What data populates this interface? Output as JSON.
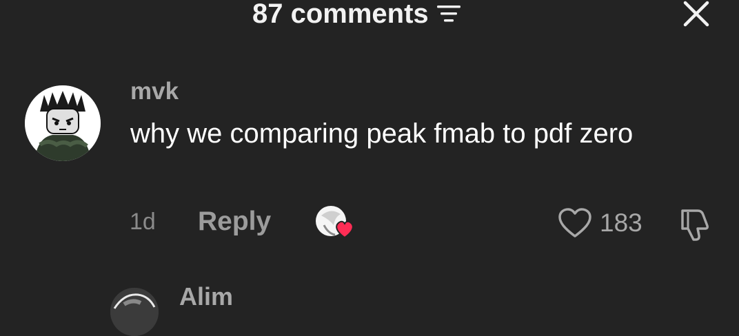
{
  "header": {
    "title": "87 comments",
    "sort_icon": "sort-lines-icon",
    "close_icon": "close-icon"
  },
  "comment": {
    "username": "mvk",
    "text": "why we comparing peak fmab to pdf zero",
    "time": "1d",
    "reply_label": "Reply",
    "likes": "183",
    "like_icon": "heart-outline-icon",
    "dislike_icon": "thumbs-down-icon",
    "creator_liked_icon": "creator-heart-avatar-icon",
    "accent_heart_color": "#ff2d55"
  },
  "next_comment": {
    "username": "Alim"
  }
}
